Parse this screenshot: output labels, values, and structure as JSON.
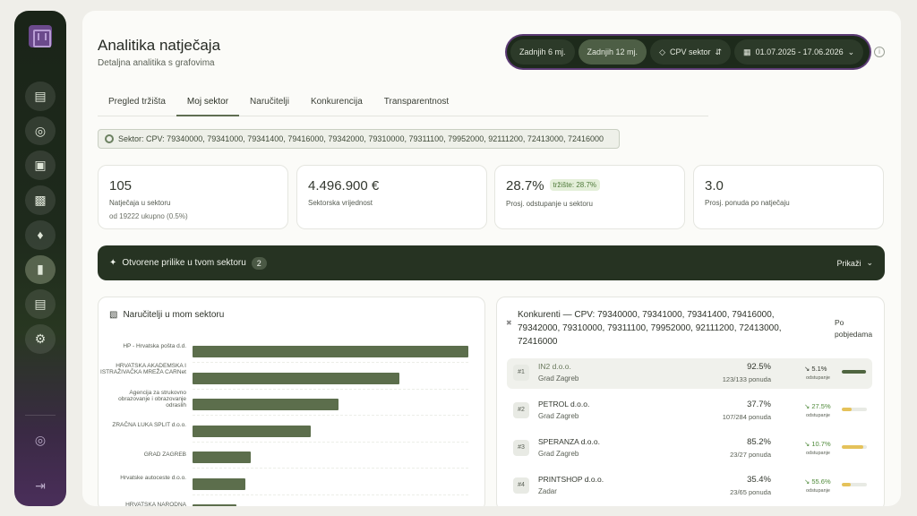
{
  "header": {
    "title": "Analitika natječaja",
    "subtitle": "Detaljna analitika s grafovima"
  },
  "toolbar": {
    "period_6": "Zadnjih 6 mj.",
    "period_12": "Zadnjih 12 mj.",
    "cpv_label": "CPV sektor",
    "date_range": "01.07.2025 - 17.06.2026"
  },
  "tabs": [
    "Pregled tržišta",
    "Moj sektor",
    "Naručitelji",
    "Konkurencija",
    "Transparentnost"
  ],
  "sector_filter": "Sektor: CPV: 79340000, 79341000, 79341400, 79416000, 79342000, 79310000, 79311100, 79952000, 92111200, 72413000, 72416000",
  "stats": [
    {
      "value": "105",
      "label": "Natječaja u sektoru",
      "sub": "od 19222 ukupno (0.5%)"
    },
    {
      "value": "4.496.900 €",
      "label": "Sektorska vrijednost"
    },
    {
      "value": "28.7%",
      "badge": "tržište: 28.7%",
      "label": "Prosj. odstupanje u sektoru"
    },
    {
      "value": "3.0",
      "label": "Prosj. ponuda po natječaju"
    }
  ],
  "banner": {
    "title": "Otvorene prilike u tvom sektoru",
    "count": "2",
    "action": "Prikaži"
  },
  "buyers_panel": {
    "title": "Naručitelji u mom sektoru",
    "bars": [
      {
        "label": "HP - Hrvatska pošta d.d.",
        "value": 1.0
      },
      {
        "label": "HRVATSKA AKADEMSKA I ISTRAŽIVAČKA MREŽA CARNet",
        "value": 0.75
      },
      {
        "label": "Agencija za strukovno obrazovanje i obrazovanje odraslih",
        "value": 0.53
      },
      {
        "label": "ZRAČNA LUKA SPLIT d.o.o.",
        "value": 0.43
      },
      {
        "label": "GRAD ZAGREB",
        "value": 0.21
      },
      {
        "label": "Hrvatske autoceste d.o.o.",
        "value": 0.19
      },
      {
        "label": "HRVATSKA NARODNA",
        "value": 0.16
      }
    ]
  },
  "competitors_panel": {
    "title": "Konkurenti — CPV: 79340000, 79341000, 79341400, 79416000, 79342000, 79310000, 79311100, 79952000, 92111200, 72413000, 72416000",
    "sort_label": "Po pobjedama",
    "rows": [
      {
        "rank": "#1",
        "name": "IN2 d.o.o.",
        "city": "Grad Zagreb",
        "pct": "92.5%",
        "bids": "123/133 ponuda",
        "trend": "5.1%",
        "dev": "odstupanje",
        "bar": 0.95,
        "bar_color": "#4f6540",
        "trend_green": false
      },
      {
        "rank": "#2",
        "name": "PETROL d.o.o.",
        "city": "Grad Zagreb",
        "pct": "37.7%",
        "bids": "107/284 ponuda",
        "trend": "27.5%",
        "dev": "odstupanje",
        "bar": 0.38,
        "bar_color": "#e5c25a",
        "trend_green": true
      },
      {
        "rank": "#3",
        "name": "SPERANZA d.o.o.",
        "city": "Grad Zagreb",
        "pct": "85.2%",
        "bids": "23/27 ponuda",
        "trend": "10.7%",
        "dev": "odstupanje",
        "bar": 0.85,
        "bar_color": "#e5c25a",
        "trend_green": true
      },
      {
        "rank": "#4",
        "name": "PRINTSHOP d.o.o.",
        "city": "Zadar",
        "pct": "35.4%",
        "bids": "23/65 ponuda",
        "trend": "55.6%",
        "dev": "odstupanje",
        "bar": 0.35,
        "bar_color": "#e5c25a",
        "trend_green": true
      }
    ]
  }
}
